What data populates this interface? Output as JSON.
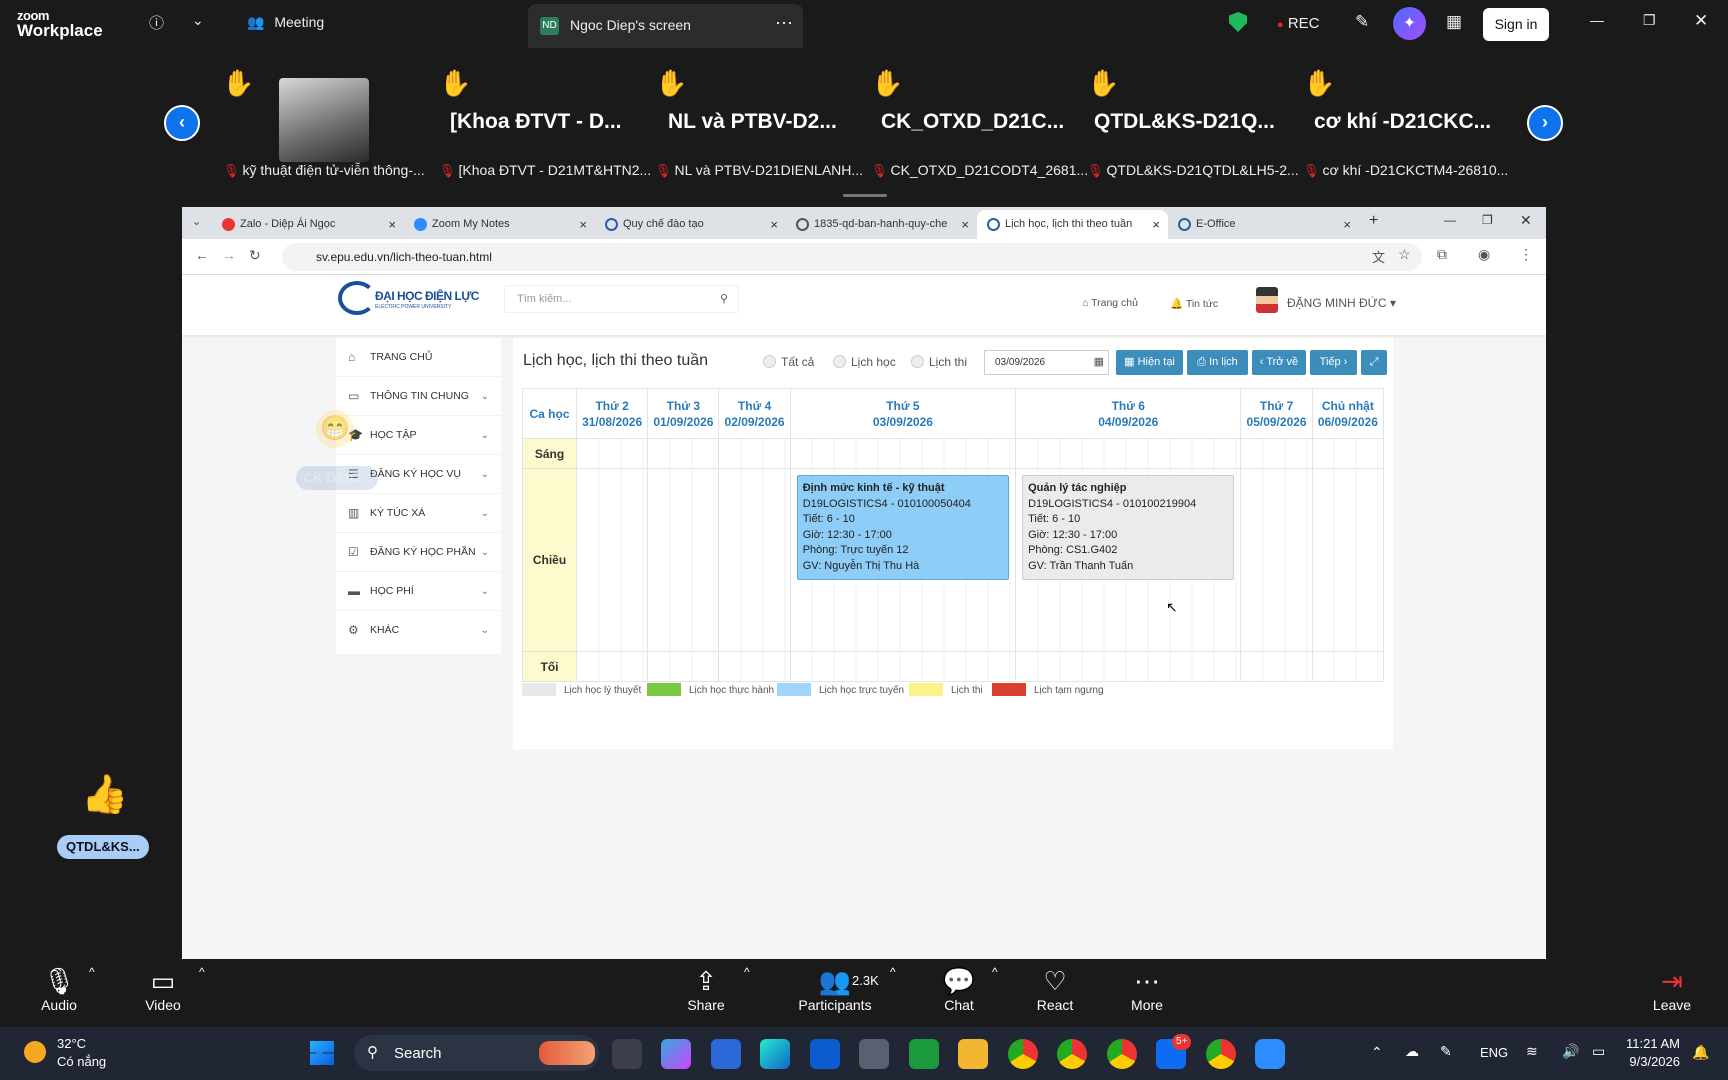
{
  "zoom": {
    "logo_top": "zoom",
    "logo_bottom": "Workplace",
    "meeting_label": "Meeting",
    "share_badge": "ND",
    "share_label": "Ngoc Diep's screen",
    "rec_label": "REC",
    "signin_label": "Sign in"
  },
  "gallery": {
    "tiles": [
      {
        "name": "",
        "caption": "kỹ thuật điện tử-viễn thông-..."
      },
      {
        "name": "[Khoa ĐTVT - D...",
        "caption": "[Khoa ĐTVT - D21MT&HTN2..."
      },
      {
        "name": "NL và PTBV-D2...",
        "caption": "NL và PTBV-D21DIENLANH..."
      },
      {
        "name": "CK_OTXD_D21C...",
        "caption": "CK_OTXD_D21CODT4_2681..."
      },
      {
        "name": "QTDL&KS-D21Q...",
        "caption": "QTDL&KS-D21QTDL&LH5-2..."
      },
      {
        "name": "cơ khí -D21CKC...",
        "caption": "cơ khí -D21CKCTM4-26810..."
      }
    ],
    "reaction_label": "QTDL&KS...",
    "ghost_label": "CK-D21C..."
  },
  "browser": {
    "tabs": [
      {
        "label": "Zalo - Diệp Ái Ngọc"
      },
      {
        "label": "Zoom My Notes"
      },
      {
        "label": "Quy chế đào tạo"
      },
      {
        "label": "1835-qd-ban-hanh-quy-che"
      },
      {
        "label": "Lịch học, lịch thi theo tuần"
      },
      {
        "label": "E-Office"
      }
    ],
    "url": "sv.epu.edu.vn/lich-theo-tuan.html"
  },
  "site": {
    "logo_text": "ĐẠI HỌC ĐIỆN LỰC",
    "logo_sub": "ELECTRIC POWER UNIVERSITY",
    "search_placeholder": "Tìm kiếm...",
    "nav_home": "Trang chủ",
    "nav_news": "Tin tức",
    "user_name": "ĐẶNG MINH ĐỨC",
    "menu": [
      "TRANG CHỦ",
      "THÔNG TIN CHUNG",
      "HỌC TẬP",
      "ĐĂNG KÝ HỌC VỤ",
      "KÝ TÚC XÁ",
      "ĐĂNG KÝ HỌC PHẦN",
      "HỌC PHÍ",
      "KHÁC"
    ],
    "page_title": "Lịch học, lịch thi theo tuần",
    "filter_all": "Tất cả",
    "filter_study": "Lịch học",
    "filter_exam": "Lịch thi",
    "date_value": "03/09/2026",
    "btn_current": "Hiện tại",
    "btn_print": "In lịch",
    "btn_back": "‹ Trở về",
    "btn_next": "Tiếp ›",
    "col_slot": "Ca học",
    "days": [
      {
        "name": "Thứ 2",
        "date": "31/08/2026"
      },
      {
        "name": "Thứ 3",
        "date": "01/09/2026"
      },
      {
        "name": "Thứ 4",
        "date": "02/09/2026"
      },
      {
        "name": "Thứ 5",
        "date": "03/09/2026"
      },
      {
        "name": "Thứ 6",
        "date": "04/09/2026"
      },
      {
        "name": "Thứ 7",
        "date": "05/09/2026"
      },
      {
        "name": "Chủ nhật",
        "date": "06/09/2026"
      }
    ],
    "slots": [
      "Sáng",
      "Chiều",
      "Tối"
    ],
    "events": [
      {
        "title": "Định mức kinh tế - kỹ thuật",
        "code": "D19LOGISTICS4 - 010100050404",
        "period": "Tiết: 6 - 10",
        "time": "Giờ: 12:30 - 17:00",
        "room": "Phòng: Trực tuyến 12",
        "teacher": "GV: Nguyễn Thị Thu Hà",
        "color": "#8ecdf7"
      },
      {
        "title": "Quản lý tác nghiệp",
        "code": "D19LOGISTICS4 - 010100219904",
        "period": "Tiết: 6 - 10",
        "time": "Giờ: 12:30 - 17:00",
        "room": "Phòng: CS1.G402",
        "teacher": "GV: Trần Thanh Tuấn",
        "color": "#ebebeb"
      }
    ],
    "legend": [
      {
        "label": "Lịch học lý thuyết",
        "color": "#e8e8e8"
      },
      {
        "label": "Lịch học thực hành",
        "color": "#7ac943"
      },
      {
        "label": "Lịch học trực tuyến",
        "color": "#9fd4fb"
      },
      {
        "label": "Lịch thi",
        "color": "#fbf38a"
      },
      {
        "label": "Lịch tạm ngưng",
        "color": "#d9402e"
      }
    ]
  },
  "controls": {
    "audio": "Audio",
    "video": "Video",
    "share": "Share",
    "participants": "Participants",
    "participants_count": "2.3K",
    "chat": "Chat",
    "react": "React",
    "more": "More",
    "leave": "Leave"
  },
  "taskbar": {
    "weather_temp": "32°C",
    "weather_desc": "Có nắng",
    "search": "Search",
    "lang": "ENG",
    "time": "11:21 AM",
    "date": "9/3/2026",
    "zalo_badge": "5+"
  }
}
